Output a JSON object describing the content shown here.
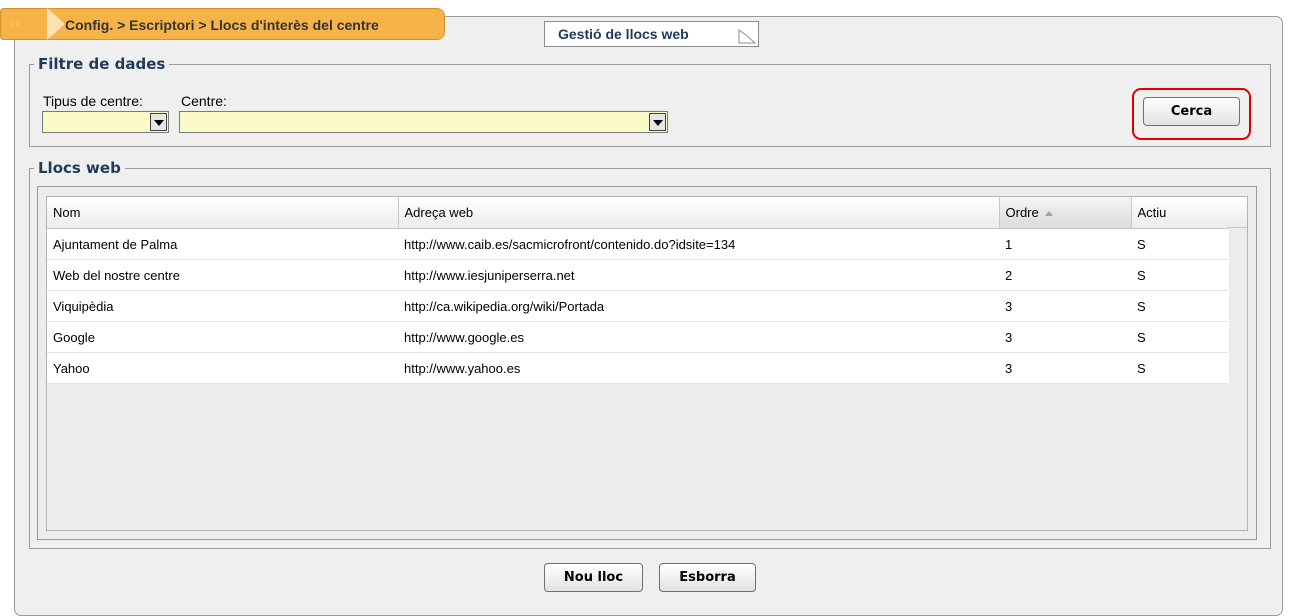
{
  "breadcrumb": {
    "text": "Config. > Escriptori > Llocs d'interès del centre",
    "grip": "::"
  },
  "page_tab": {
    "title": "Gestió de llocs web"
  },
  "filter": {
    "legend": "Filtre de dades",
    "tipus_label": "Tipus de centre:",
    "centre_label": "Centre:",
    "tipus_value": "",
    "centre_value": "",
    "search_label": "Cerca"
  },
  "websites": {
    "legend": "Llocs web",
    "columns": {
      "nom": "Nom",
      "adreca": "Adreça web",
      "ordre": "Ordre",
      "actiu": "Actiu"
    },
    "rows": [
      {
        "nom": "Ajuntament de Palma",
        "adreca": "http://www.caib.es/sacmicrofront/contenido.do?idsite=134",
        "ordre": "1",
        "actiu": "S"
      },
      {
        "nom": "Web del nostre centre",
        "adreca": "http://www.iesjuniperserra.net",
        "ordre": "2",
        "actiu": "S"
      },
      {
        "nom": "Viquipèdia",
        "adreca": "http://ca.wikipedia.org/wiki/Portada",
        "ordre": "3",
        "actiu": "S"
      },
      {
        "nom": "Google",
        "adreca": "http://www.google.es",
        "ordre": "3",
        "actiu": "S"
      },
      {
        "nom": "Yahoo",
        "adreca": "http://www.yahoo.es",
        "ordre": "3",
        "actiu": "S"
      }
    ]
  },
  "footer": {
    "new_label": "Nou lloc",
    "delete_label": "Esborra"
  },
  "colors": {
    "breadcrumb_bg": "#f6b347",
    "combo_bg": "#fbfbc8",
    "highlight": "#e00000",
    "legend_text": "#1f3b5a"
  }
}
